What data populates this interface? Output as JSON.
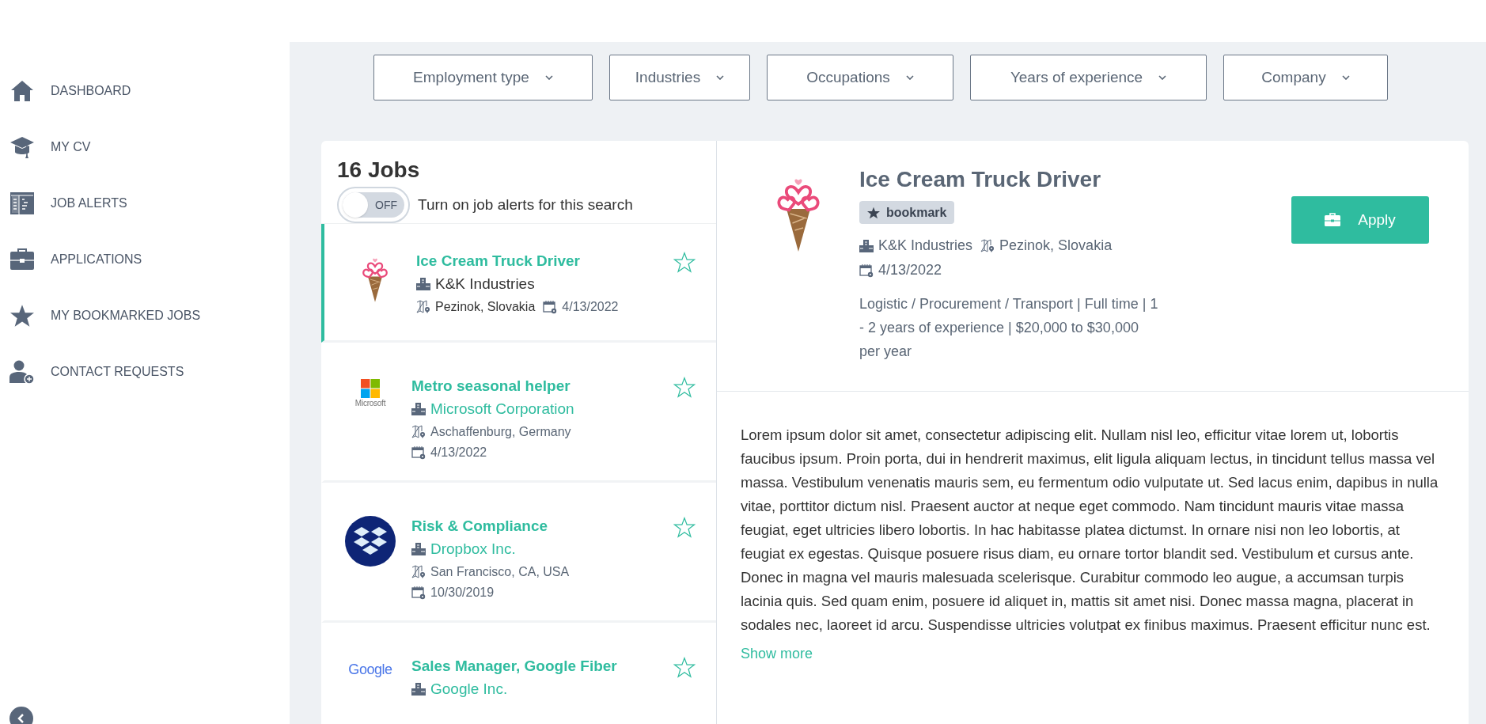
{
  "sidebar": {
    "items": [
      {
        "label": "DASHBOARD"
      },
      {
        "label": "MY CV"
      },
      {
        "label": "JOB ALERTS"
      },
      {
        "label": "APPLICATIONS"
      },
      {
        "label": "MY BOOKMARKED JOBS"
      },
      {
        "label": "CONTACT REQUESTS"
      }
    ]
  },
  "filters": [
    "Employment type",
    "Industries",
    "Occupations",
    "Years of experience",
    "Company"
  ],
  "job_list": {
    "title": "16 Jobs",
    "alert_toggle": {
      "on": false,
      "state_label": "OFF",
      "label": "Turn on job alerts for this search"
    },
    "jobs": [
      {
        "title": "Ice Cream Truck Driver",
        "company": "K&K Industries",
        "location": "Pezinok, Slovakia",
        "date": "4/13/2022",
        "selected": true,
        "bookmarked": false
      },
      {
        "logo_text": "Microsoft",
        "title": "Metro seasonal helper",
        "company": "Microsoft Corporation",
        "location": "Aschaffenburg, Germany",
        "date": "4/13/2022",
        "selected": false,
        "bookmarked": false
      },
      {
        "title": "Risk & Compliance",
        "company": "Dropbox Inc.",
        "location": "San Francisco, CA, USA",
        "date": "10/30/2019",
        "selected": false,
        "bookmarked": false
      },
      {
        "logo_text": "Google",
        "title": "Sales Manager, Google Fiber",
        "company": "Google Inc.",
        "selected": false,
        "bookmarked": false
      }
    ]
  },
  "detail": {
    "title": "Ice Cream Truck Driver",
    "bookmark_label": "bookmark",
    "company": "K&K Industries",
    "location": "Pezinok, Slovakia",
    "date": "4/13/2022",
    "summary": "Logistic / Procurement / Transport | Full time | 1 - 2 years of experience | $20,000 to $30,000 per year",
    "apply_label": "Apply",
    "description": "Lorem ipsum dolor sit amet, consectetur adipiscing elit. Nullam nisl leo, efficitur vitae lorem ut, lobortis faucibus ipsum. Proin porta, dui in hendrerit maximus, elit ligula aliquam lectus, in tincidunt tellus massa vel massa. Vestibulum venenatis mauris sem, eu fermentum odio vulputate ut. Sed lacus enim, dapibus in nulla vitae, porttitor dictum nisl. Praesent auctor at neque eget commodo. Nam tincidunt mauris vitae massa feugiat, eget ultricies libero lobortis. In hac habitasse platea dictumst. In ornare nisi non leo lobortis, at feugiat ex egestas. Quisque posuere risus diam, eu ornare tortor blandit sed. Vestibulum et cursus ante. Donec in magna vel mauris malesuada scelerisque. Curabitur commodo leo augue, a accumsan turpis lacinia quis. Sed quam enim, posuere id aliquet in, mattis sit amet nisi. Donec massa magna, placerat in sodales nec, laoreet id arcu. Suspendisse ultricies volutpat ex finibus maximus. Praesent efficitur nunc est.",
    "show_more": "Show more"
  }
}
